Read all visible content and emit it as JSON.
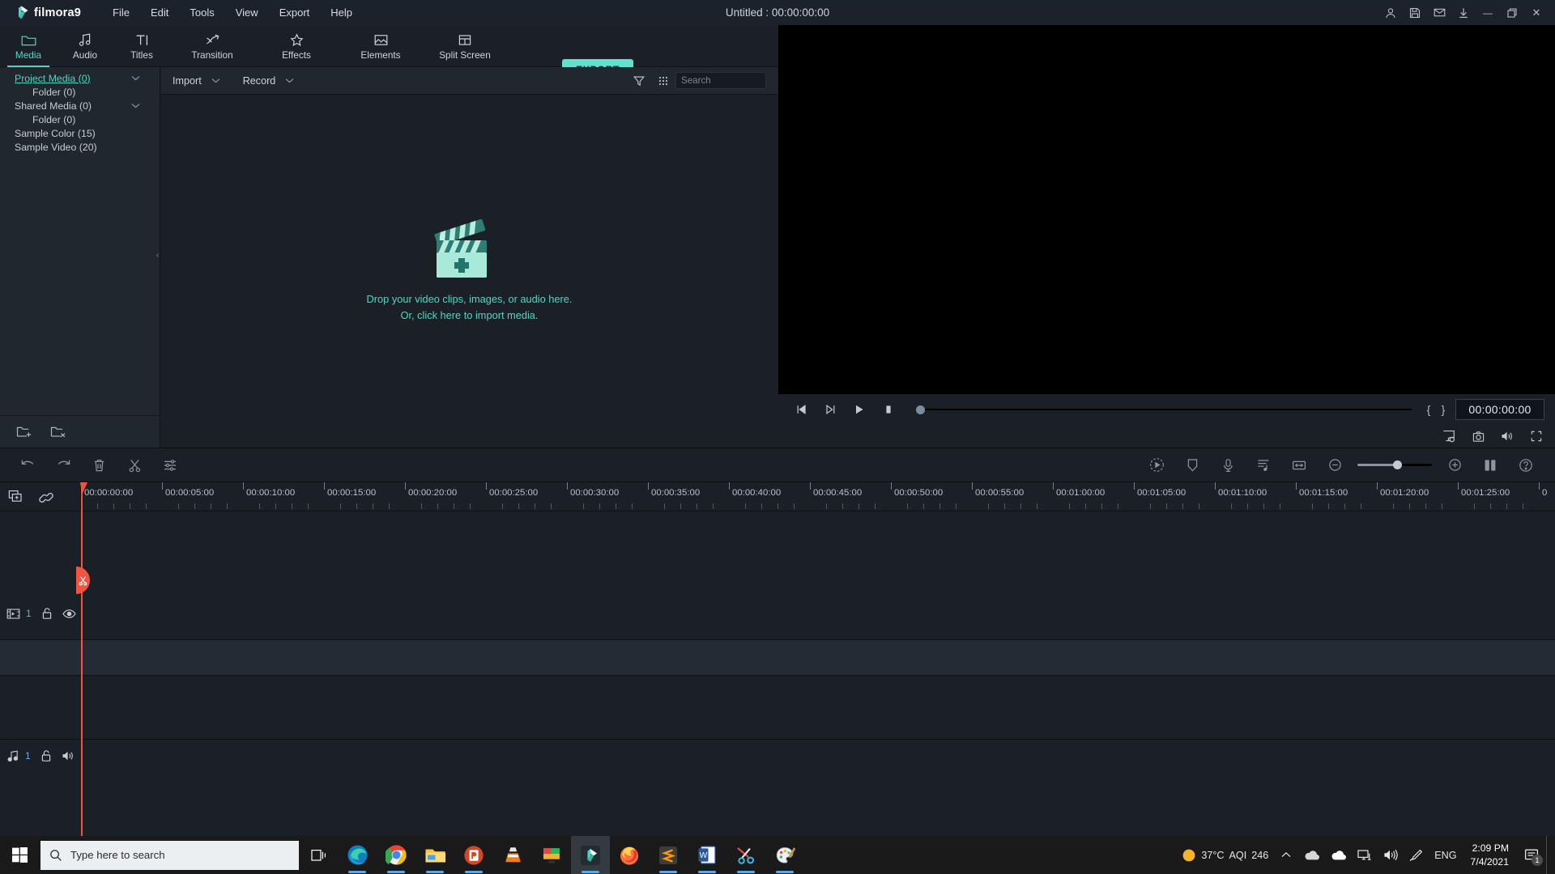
{
  "window": {
    "app_name": "filmora9",
    "title": "Untitled : 00:00:00:00",
    "logo_color": "#4fd6c2",
    "accent_color": "#4fd6c2",
    "export_button_color": "#65dfc9"
  },
  "menu": {
    "items": [
      {
        "label": "File",
        "name": "menu-file"
      },
      {
        "label": "Edit",
        "name": "menu-edit"
      },
      {
        "label": "Tools",
        "name": "menu-tools"
      },
      {
        "label": "View",
        "name": "menu-view"
      },
      {
        "label": "Export",
        "name": "menu-export"
      },
      {
        "label": "Help",
        "name": "menu-help"
      }
    ]
  },
  "title_controls": {
    "account": "account-icon",
    "save": "save-icon",
    "mail": "mail-icon",
    "download": "download-icon",
    "minimize": "—",
    "maximize": "❐",
    "close": "✕"
  },
  "tabs": {
    "items": [
      {
        "label": "Media",
        "icon": "folder-icon",
        "active": true
      },
      {
        "label": "Audio",
        "icon": "music-note-icon",
        "active": false
      },
      {
        "label": "Titles",
        "icon": "text-icon",
        "active": false
      },
      {
        "label": "Transition",
        "icon": "transition-arrows-icon",
        "active": false
      },
      {
        "label": "Effects",
        "icon": "sparkle-icon",
        "active": false
      },
      {
        "label": "Elements",
        "icon": "image-icon",
        "active": false
      },
      {
        "label": "Split Screen",
        "icon": "grid-layout-icon",
        "active": false
      }
    ],
    "export_label": "EXPORT"
  },
  "sidebar": {
    "items": [
      {
        "label": "Project Media (0)",
        "indent": false,
        "selected": true,
        "chevron": true
      },
      {
        "label": "Folder (0)",
        "indent": true,
        "selected": false,
        "chevron": false
      },
      {
        "label": "Shared Media (0)",
        "indent": false,
        "selected": false,
        "chevron": true
      },
      {
        "label": "Folder (0)",
        "indent": true,
        "selected": false,
        "chevron": false
      },
      {
        "label": "Sample Color (15)",
        "indent": false,
        "selected": false,
        "chevron": false
      },
      {
        "label": "Sample Video (20)",
        "indent": false,
        "selected": false,
        "chevron": false
      }
    ],
    "footer": {
      "new_folder": "new-folder-icon",
      "delete_folder": "delete-folder-icon"
    },
    "collapse": "‹"
  },
  "media_toolbar": {
    "import_label": "Import",
    "record_label": "Record",
    "caret": "⌄",
    "filter_icon": "filter-icon",
    "grid_icon": "grid-view-icon",
    "search_placeholder": "Search",
    "search_value": ""
  },
  "dropzone": {
    "icon": "clapperboard-add-icon",
    "line1": "Drop your video clips, images, or audio here.",
    "line2": "Or, click here to import media."
  },
  "preview": {
    "controls": {
      "prev_frame": "step-back-icon",
      "next_frame": "step-forward-icon",
      "play": "play-icon",
      "stop": "stop-icon",
      "mark_in": "{",
      "mark_out": "}",
      "timecode": "00:00:00:00",
      "scrub_position_pct": 0,
      "snapshot_settings": "render-preview-icon",
      "snapshot": "camera-icon",
      "volume": "speaker-icon",
      "fullscreen": "fullscreen-icon"
    }
  },
  "timeline_toolbar": {
    "left": [
      {
        "name": "undo-icon"
      },
      {
        "name": "redo-icon"
      },
      {
        "name": "delete-icon"
      },
      {
        "name": "split-scissors-icon"
      },
      {
        "name": "adjust-sliders-icon"
      }
    ],
    "right": [
      {
        "name": "render-preview-icon"
      },
      {
        "name": "marker-icon"
      },
      {
        "name": "voiceover-mic-icon"
      },
      {
        "name": "audio-mixer-icon"
      },
      {
        "name": "fit-timeline-icon"
      }
    ],
    "zoom_out": "zoom-out-icon",
    "zoom_in": "zoom-in-icon",
    "zoom_level_pct": 50,
    "split_view": "dual-panel-icon",
    "help": "help-icon"
  },
  "timeline": {
    "head_buttons": [
      {
        "name": "add-track-icon"
      },
      {
        "name": "link-chain-icon"
      }
    ],
    "ruler": {
      "labels": [
        "00:00:00:00",
        "00:00:05:00",
        "00:00:10:00",
        "00:00:15:00",
        "00:00:20:00",
        "00:00:25:00",
        "00:00:30:00",
        "00:00:35:00",
        "00:00:40:00",
        "00:00:45:00",
        "00:00:50:00",
        "00:00:55:00",
        "00:01:00:00",
        "00:01:05:00",
        "00:01:10:00",
        "00:01:15:00",
        "00:01:20:00",
        "00:01:25:00",
        "0"
      ],
      "spacing_px": 100,
      "minor_per_major": 5
    },
    "playhead_timecode": "00:00:00:00",
    "tracks": [
      {
        "type": "video",
        "number": "1",
        "icon": "video-track-icon",
        "lock": "unlock-icon",
        "visibility": "eye-icon"
      },
      {
        "type": "audio",
        "number": "1",
        "icon": "audio-track-icon",
        "lock": "unlock-icon",
        "mute": "speaker-icon"
      }
    ],
    "cut_badge": "scissors-icon"
  },
  "taskbar": {
    "start": "windows-logo-icon",
    "search_placeholder": "Type here to search",
    "task_view": "task-view-icon",
    "apps": [
      {
        "name": "edge-icon",
        "running": true
      },
      {
        "name": "chrome-icon",
        "running": true
      },
      {
        "name": "file-explorer-icon",
        "running": true
      },
      {
        "name": "powerpoint-icon",
        "running": true
      },
      {
        "name": "vlc-icon",
        "running": false
      },
      {
        "name": "screen-recorder-icon",
        "running": false
      },
      {
        "name": "filmora-icon",
        "running": true,
        "active": true
      },
      {
        "name": "firefox-icon",
        "running": false
      },
      {
        "name": "sublime-icon",
        "running": true
      },
      {
        "name": "word-icon",
        "running": true
      },
      {
        "name": "snipping-tool-icon",
        "running": true
      },
      {
        "name": "paint-icon",
        "running": true
      }
    ],
    "tray": {
      "weather_temp": "37°C",
      "aqi_label": "AQI",
      "aqi_value": "246",
      "chevron": "show-hidden-icons",
      "onedrive": "onedrive-icon",
      "cloud": "cloud-icon",
      "network": "network-icon",
      "volume": "speaker-icon",
      "pen": "pen-icon",
      "language": "ENG",
      "time": "2:09 PM",
      "date": "7/4/2021",
      "notification_count": "1"
    }
  }
}
